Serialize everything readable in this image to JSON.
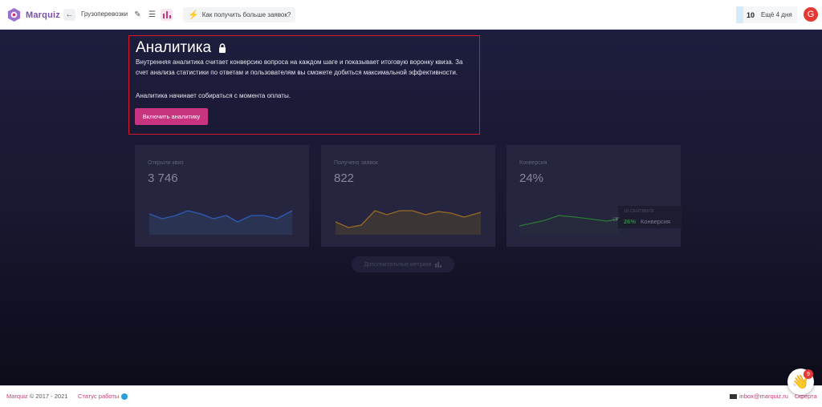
{
  "header": {
    "logo_text": "Marquiz",
    "back_icon": "arrow-left-icon",
    "quiz_name": "Грузоперевозки",
    "edit_icon": "pencil-icon",
    "list_icon": "list-icon",
    "chart_icon": "bar-chart-icon",
    "tip_icon": "lightning-icon",
    "tip_text": "Как получить больше заявок?",
    "days_count": "10",
    "days_text": "Ещё 4 дня",
    "avatar_letter": "G"
  },
  "promo": {
    "title": "Аналитика",
    "lock_icon": "lock-icon",
    "description": "Внутренняя аналитика считает конверсию вопроса на каждом шаге и показывает итоговую воронку квиза. За счет анализа статистики по ответам и пользователям вы сможете добиться максимальной эффективности.",
    "note": "Аналитика начинает собираться с момента оплаты.",
    "button_label": "Включить аналитику"
  },
  "cards": [
    {
      "label": "Открыли квиз",
      "value": "3 746",
      "color": "#2e5bb8",
      "fill": "#2a3352"
    },
    {
      "label": "Получено заявок",
      "value": "822",
      "color": "#9a6a22",
      "fill": "#3b3535"
    },
    {
      "label": "Конверсия",
      "value": "24%",
      "color": "#2a7a36",
      "fill": "#27293d"
    }
  ],
  "tooltip": {
    "date": "18 СЕНТЯБРЯ",
    "value": "26%",
    "label": "Конверсия"
  },
  "more_metrics": {
    "label": "Дополнительные метрики",
    "icon": "bar-chart-icon"
  },
  "footer": {
    "brand": "Marquiz",
    "copyright": "© 2017 - 2021",
    "status_link": "Статус работы",
    "telegram_icon": "telegram-icon",
    "mail_icon": "mail-icon",
    "email": "inbox@marquiz.ru",
    "offer": "Оферта"
  },
  "chat": {
    "icon": "waving-hand-icon",
    "badge": "9"
  }
}
